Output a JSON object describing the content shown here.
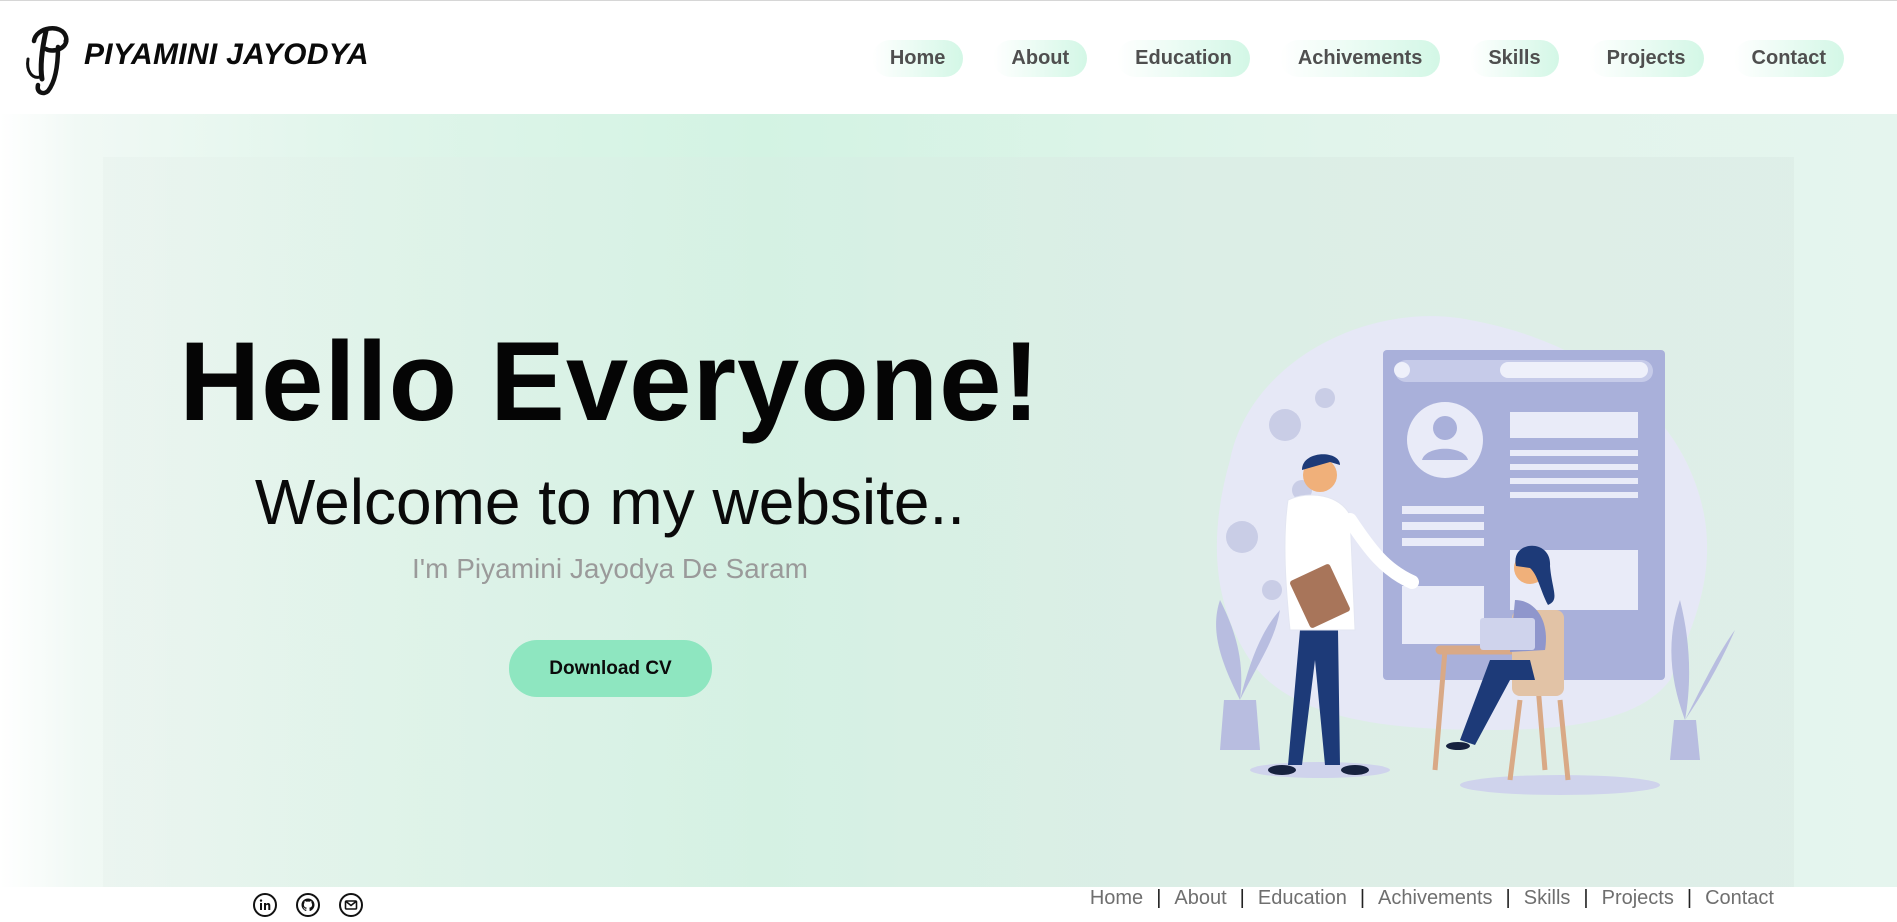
{
  "header": {
    "logo_text": "PIYAMINI JAYODYA",
    "nav": [
      {
        "label": "Home"
      },
      {
        "label": "About"
      },
      {
        "label": "Education"
      },
      {
        "label": "Achivements"
      },
      {
        "label": "Skills"
      },
      {
        "label": "Projects"
      },
      {
        "label": "Contact"
      }
    ]
  },
  "hero": {
    "title": "Hello Everyone!",
    "subtitle": "Welcome to my website..",
    "name": "I'm Piyamini Jayodya De Saram",
    "cta_label": "Download CV"
  },
  "footer": {
    "social": [
      {
        "icon": "linkedin-icon"
      },
      {
        "icon": "github-icon"
      },
      {
        "icon": "mail-icon"
      }
    ],
    "links": [
      {
        "label": "Home"
      },
      {
        "label": "About"
      },
      {
        "label": "Education"
      },
      {
        "label": "Achivements"
      },
      {
        "label": "Skills"
      },
      {
        "label": "Projects"
      },
      {
        "label": "Contact"
      }
    ],
    "separator": "|"
  },
  "colors": {
    "accent": "#8ee6c0",
    "nav_pill": "#d3f7e6",
    "text_dark": "#050505",
    "text_muted": "#9a9a9a"
  }
}
